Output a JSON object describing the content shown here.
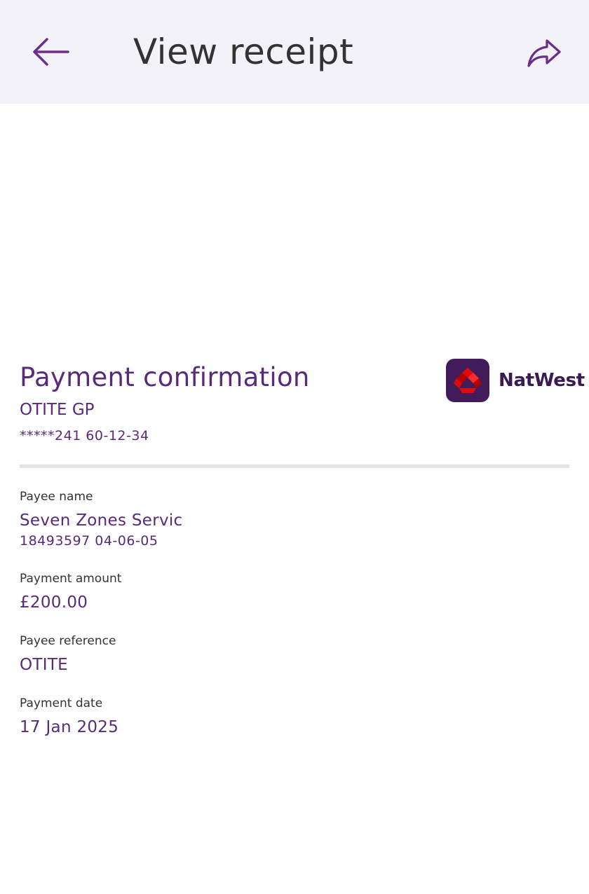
{
  "header": {
    "title": "View receipt",
    "back_icon": "arrow-left-icon",
    "share_icon": "share-forward-icon"
  },
  "receipt": {
    "heading": "Payment confirmation",
    "account_name": "OTITE GP",
    "account_number": "*****241 60-12-34",
    "brand": {
      "name": "NatWest",
      "logo_icon": "natwest-cubes-logo"
    },
    "fields": [
      {
        "label": "Payee name",
        "value": "Seven Zones Servic",
        "sub": "18493597 04-06-05"
      },
      {
        "label": "Payment amount",
        "value": "£200.00"
      },
      {
        "label": "Payee reference",
        "value": "OTITE"
      },
      {
        "label": "Payment date",
        "value": "17 Jan 2025"
      }
    ]
  },
  "colors": {
    "accent": "#5a2a7a",
    "header_bg": "#f3f2f8",
    "logo_bg": "#421c5a",
    "logo_red": "#e10a0a"
  }
}
